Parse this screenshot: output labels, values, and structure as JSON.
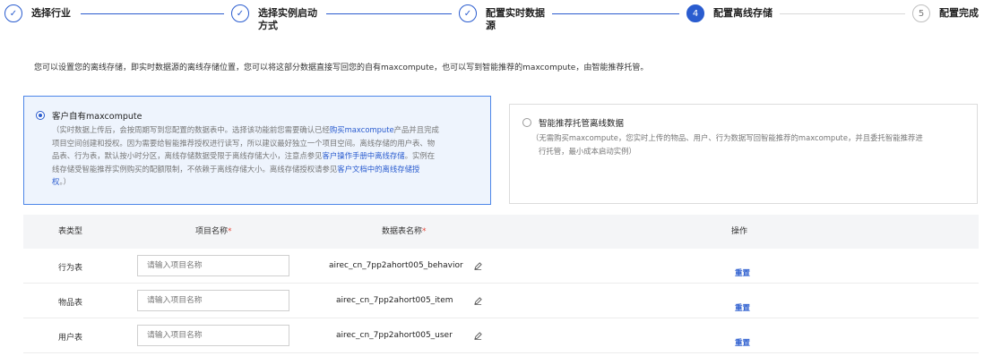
{
  "steps": [
    {
      "label_line1": "选择行业",
      "label_line2": "",
      "number": "✓",
      "state": "done"
    },
    {
      "label_line1": "选择实例启动",
      "label_line2": "方式",
      "number": "✓",
      "state": "done"
    },
    {
      "label_line1": "配置实时数据",
      "label_line2": "源",
      "number": "✓",
      "state": "done"
    },
    {
      "label_line1": "配置离线存储",
      "label_line2": "",
      "number": "4",
      "state": "active"
    },
    {
      "label_line1": "配置完成",
      "label_line2": "",
      "number": "5",
      "state": "todo"
    }
  ],
  "description": "您可以设置您的离线存储，即实时数据源的离线存储位置，您可以将这部分数据直接写回您的自有maxcompute，也可以写到智能推荐的maxcompute，由智能推荐托管。",
  "options": {
    "own": {
      "title": "客户自有maxcompute",
      "line1_a": "（实时数据上传后，会按周期写到您配置的数据表中。选择该功能前您需要确认已经",
      "line1_link": "购买maxcompute",
      "line1_b": "产品并且完成",
      "line2": "项目空间创建和授权。因为需要给智能推荐授权进行读写，所以建议最好独立一个项目空间。离线存储的用户表、物",
      "line3_a": "品表、行为表，默认按小时分区，离线存储数据受限于离线存储大小，注意点参见",
      "line3_link": "客户操作手册中离线存储",
      "line3_b": "。实例在",
      "line4_a": "线存储受智能推荐实例购买的配额限制，不依赖于离线存储大小。离线存储授权请参见",
      "line4_link": "客户文档中的离线存储授",
      "line5_link": "权",
      "line5_b": "。）"
    },
    "managed": {
      "title": "智能推荐托管离线数据",
      "line1": "（无需购买maxcompute，您实时上传的物品、用户、行为数据写回智能推荐的maxcompute，并且委托智能推荐进",
      "line2": "行托管，最小成本启动实例）"
    }
  },
  "table": {
    "headers": {
      "type": "表类型",
      "project": "项目名称",
      "table_name": "数据表名称",
      "action": "操作",
      "required_mark": "*"
    },
    "rows": [
      {
        "type": "行为表",
        "placeholder": "请输入项目名称",
        "table_name": "airec_cn_7pp2ahort005_behavior",
        "action": "重置"
      },
      {
        "type": "物品表",
        "placeholder": "请输入项目名称",
        "table_name": "airec_cn_7pp2ahort005_item",
        "action": "重置"
      },
      {
        "type": "用户表",
        "placeholder": "请输入项目名称",
        "table_name": "airec_cn_7pp2ahort005_user",
        "action": "重置"
      }
    ]
  }
}
